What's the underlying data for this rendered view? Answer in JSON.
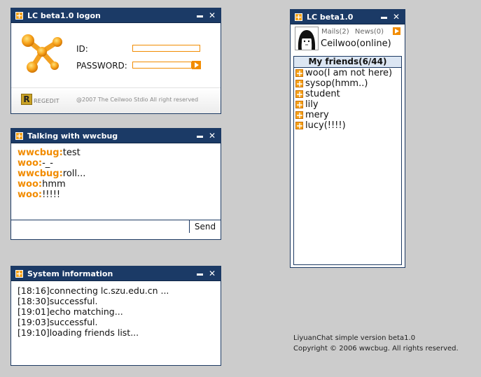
{
  "logon": {
    "title": "LC beta1.0 logon",
    "id_label": "ID:",
    "id_value": "",
    "password_label": "PASSWORD:",
    "password_value": "",
    "regedit_icon_letter": "R",
    "regedit_label": "REGEDIT",
    "copyright": "@2007 The Ceilwoo Stdio All right reserved"
  },
  "talk": {
    "title": "Talking with wwcbug",
    "messages": [
      {
        "sender": "wwcbug:",
        "text": "test"
      },
      {
        "sender": "woo:",
        "text": "-_-"
      },
      {
        "sender": "wwcbug:",
        "text": "roll..."
      },
      {
        "sender": "woo:",
        "text": "hmm"
      },
      {
        "sender": "woo:",
        "text": "!!!!!"
      }
    ],
    "input_value": "",
    "send_label": "Send"
  },
  "system": {
    "title": "System information",
    "lines": [
      "[18:16]connecting lc.szu.edu.cn ...",
      "[18:30]successful.",
      "[19:01]echo matching...",
      "[19:03]successful.",
      "[19:10]loading friends list..."
    ]
  },
  "friends": {
    "title": "LC beta1.0",
    "mails": "Mails(2)",
    "news": "News(0)",
    "user": "Ceilwoo(online)",
    "list_header": "My friends(6/44)",
    "items": [
      "woo(I am not here)",
      "sysop(hmm..)",
      "student",
      "lily",
      "mery",
      "lucy(!!!!)"
    ]
  },
  "about": {
    "line1": "LiyuanChat simple version beta1.0",
    "line2": "Copyright © 2006 wwcbug. All rights reserved."
  },
  "icons": {
    "window": "lc-logo-icon",
    "minimize": "minimize-icon",
    "close": "close-icon",
    "go": "arrow-right-icon",
    "friend": "friend-icon"
  },
  "colors": {
    "titlebar": "#1b3a66",
    "accent": "#f28c00",
    "background": "#cccccc"
  }
}
